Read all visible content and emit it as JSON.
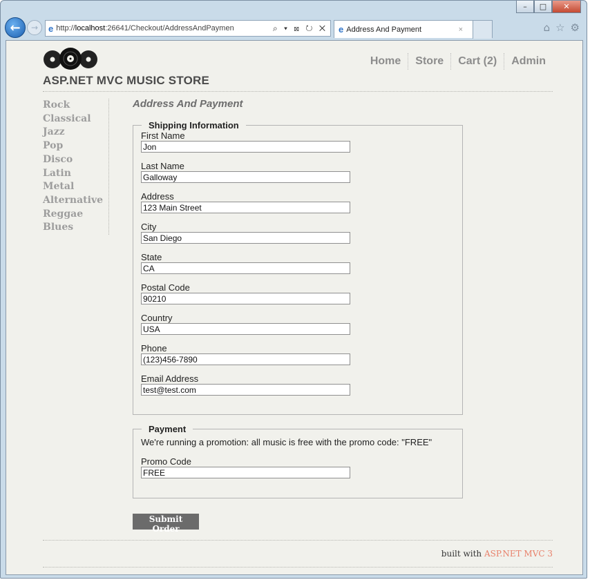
{
  "browser": {
    "url_prefix": "http://",
    "url_host": "localhost",
    "url_rest": ":26641/Checkout/AddressAndPaymen",
    "address_controls": "⌕ ▾ ⊠ ↻ ✕",
    "tab_title": "Address And Payment",
    "tab_close": "×",
    "window_buttons": {
      "minimize": "–",
      "maximize": "□",
      "close": "✕"
    },
    "icons": {
      "home": "home-icon",
      "favorites": "star-icon",
      "tools": "gear-icon"
    }
  },
  "site": {
    "title": "ASP.NET MVC MUSIC STORE",
    "nav": [
      "Home",
      "Store",
      "Cart (2)",
      "Admin"
    ]
  },
  "genres": [
    "Rock",
    "Classical",
    "Jazz",
    "Pop",
    "Disco",
    "Latin",
    "Metal",
    "Alternative",
    "Reggae",
    "Blues"
  ],
  "page": {
    "heading": "Address And Payment"
  },
  "shipping": {
    "legend": "Shipping Information",
    "fields": [
      {
        "label": "First Name",
        "value": "Jon"
      },
      {
        "label": "Last Name",
        "value": "Galloway"
      },
      {
        "label": "Address",
        "value": "123 Main Street"
      },
      {
        "label": "City",
        "value": "San Diego"
      },
      {
        "label": "State",
        "value": "CA"
      },
      {
        "label": "Postal Code",
        "value": "90210"
      },
      {
        "label": "Country",
        "value": "USA"
      },
      {
        "label": "Phone",
        "value": "(123)456-7890"
      },
      {
        "label": "Email Address",
        "value": "test@test.com"
      }
    ]
  },
  "payment": {
    "legend": "Payment",
    "promo_text": "We're running a promotion: all music is free with the promo code: \"FREE\"",
    "promo_label": "Promo Code",
    "promo_value": "FREE"
  },
  "submit_label": "Submit Order",
  "footer": {
    "prefix": "built with ",
    "brand": "ASP.NET MVC 3"
  },
  "colors": {
    "page_bg": "#f1f1ec",
    "footer_brand": "#e8806a",
    "button_bg": "#6b6b6b"
  }
}
